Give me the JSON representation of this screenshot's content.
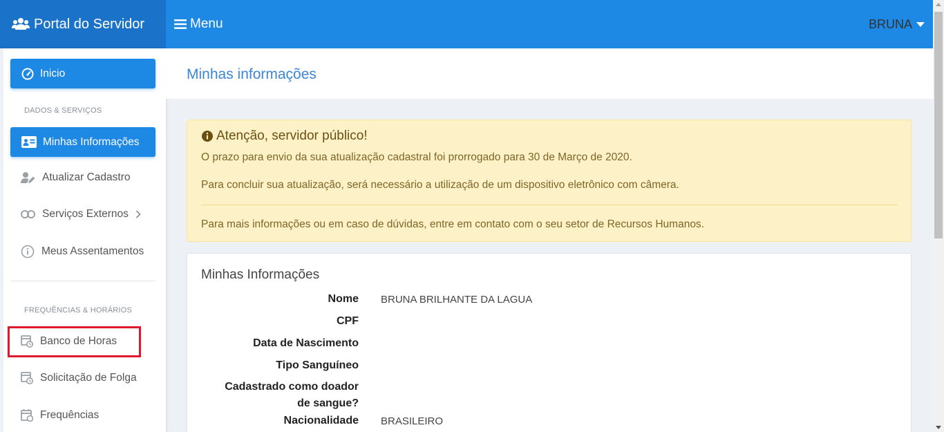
{
  "brand": {
    "title": "Portal do Servidor",
    "icon": "users-icon"
  },
  "topbar": {
    "menu_label": "Menu",
    "user_name": "BRUNA"
  },
  "sidebar": {
    "inicio": "Inicio",
    "section1": "DADOS & SERVIÇOS",
    "minhas_informacoes": "Minhas Informações",
    "atualizar_cadastro": "Atualizar Cadastro",
    "servicos_externos": "Serviços Externos",
    "meus_assentamentos": "Meus Assentamentos",
    "section2": "FREQUÊNCIAS & HORÁRIOS",
    "banco_de_horas": "Banco de Horas",
    "solicitacao_de_folga": "Solicitação de Folga",
    "frequencias": "Frequências"
  },
  "page": {
    "title": "Minhas informações"
  },
  "alert": {
    "title": "Atenção, servidor público!",
    "line1": "O prazo para envio da sua atualização cadastral foi prorrogado para 30 de Março de 2020.",
    "line2": "Para concluir sua atualização, será necessário a utilização de um dispositivo eletrônico com câmera.",
    "line3": "Para mais informações ou em caso de dúvidas, entre em contato com o seu setor de Recursos Humanos."
  },
  "info": {
    "title": "Minhas Informações",
    "nome_label": "Nome",
    "nome_value": "BRUNA BRILHANTE DA LAGUA",
    "cpf_label": "CPF",
    "nascimento_label": "Data de Nascimento",
    "sangue_label": "Tipo Sanguíneo",
    "doador_label_1": "Cadastrado como doador",
    "doador_label_2": "de sangue?",
    "nacionalidade_label": "Nacionalidade",
    "nacionalidade_value": "BRASILEIRO"
  },
  "colors": {
    "primary": "#1e88e5",
    "brand": "#1a73c9",
    "alert_bg": "#fdf2c7",
    "highlight": "#e0182d"
  }
}
